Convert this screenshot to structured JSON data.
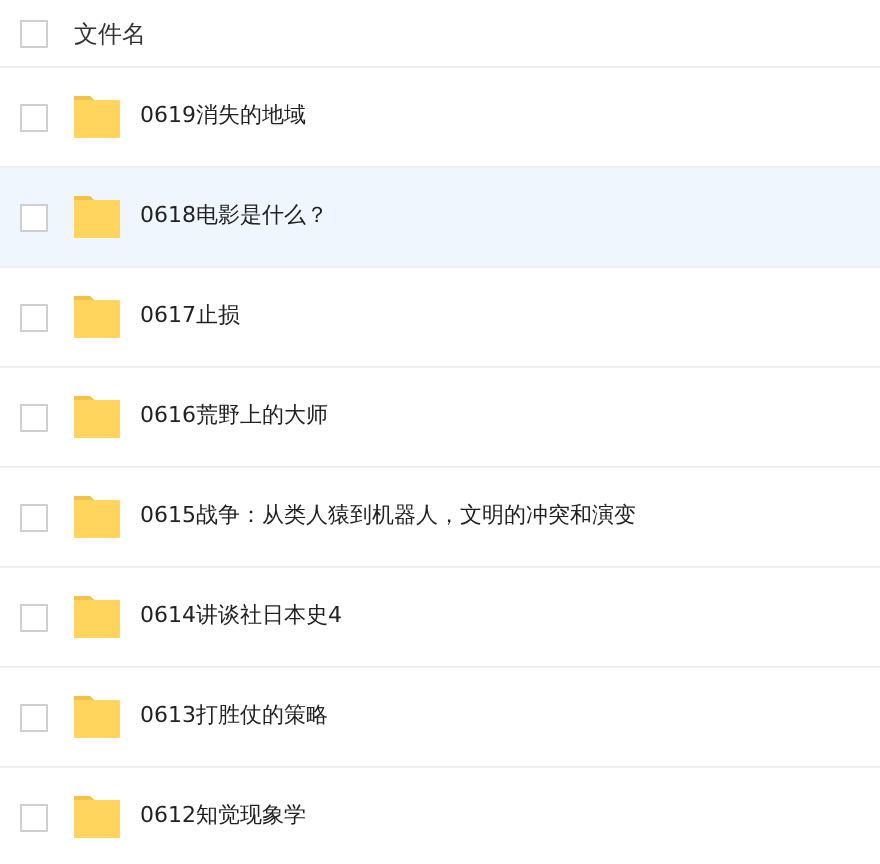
{
  "header": {
    "checked": false,
    "label": "文件名"
  },
  "files": [
    {
      "name": "0619消失的地域",
      "checked": false,
      "highlighted": false
    },
    {
      "name": "0618电影是什么？",
      "checked": false,
      "highlighted": true
    },
    {
      "name": "0617止损",
      "checked": false,
      "highlighted": false
    },
    {
      "name": "0616荒野上的大师",
      "checked": false,
      "highlighted": false
    },
    {
      "name": "0615战争：从类人猿到机器人，文明的冲突和演变",
      "checked": false,
      "highlighted": false
    },
    {
      "name": "0614讲谈社日本史4",
      "checked": false,
      "highlighted": false
    },
    {
      "name": "0613打胜仗的策略",
      "checked": false,
      "highlighted": false
    },
    {
      "name": "0612知觉现象学",
      "checked": false,
      "highlighted": false
    }
  ]
}
